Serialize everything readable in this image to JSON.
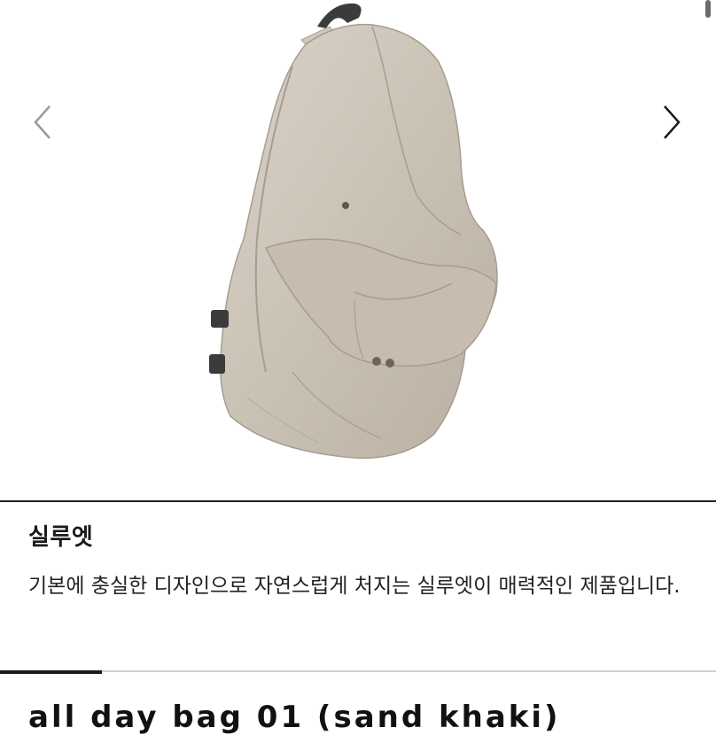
{
  "carousel": {
    "image_alt": "beige backpack",
    "prev_icon": "chevron-left-icon",
    "next_icon": "chevron-right-icon"
  },
  "feature": {
    "title": "실루엣",
    "description": "기본에 충실한 디자인으로 자연스럽게 처지는 실루엣이 매력적인 제품입니다."
  },
  "next_section": {
    "heading": "all day bag 01 (sand khaki)"
  },
  "colors": {
    "bag": "#cfc7bb",
    "divider": "#222222"
  }
}
